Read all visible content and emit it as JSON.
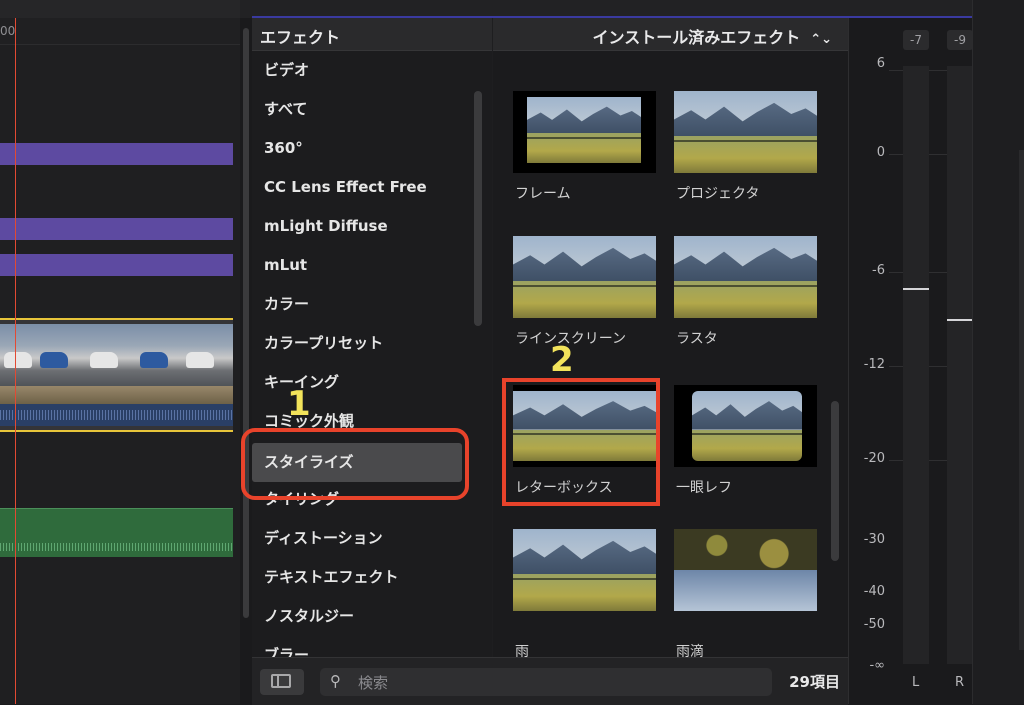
{
  "timeline": {
    "ruler_label": "00"
  },
  "effects_panel": {
    "category_header": "エフェクト",
    "grid_header": "インストール済みエフェクト",
    "categories": [
      "ビデオ",
      "すべて",
      "360°",
      "CC Lens Effect Free",
      "mLight Diffuse",
      "mLut",
      "カラー",
      "カラープリセット",
      "キーイング",
      "コミック外観",
      "スタイライズ",
      "タイリング",
      "ディストーション",
      "テキストエフェクト",
      "ノスタルジー",
      "ブラー"
    ],
    "selected_category": "スタイライズ",
    "tiles": [
      "フレーム",
      "プロジェクタ",
      "ラインスクリーン",
      "ラスタ",
      "レターボックス",
      "一眼レフ",
      "雨",
      "雨滴"
    ],
    "search": {
      "placeholder": "検索"
    },
    "item_count": "29項目"
  },
  "annotations": {
    "step1": "1",
    "step2": "2"
  },
  "audio_meter": {
    "peaks": [
      "-7",
      "-9"
    ],
    "scale": [
      "6",
      "0",
      "-6",
      "-12",
      "-20",
      "-30",
      "-40",
      "-50",
      "-∞"
    ],
    "channels": [
      "L",
      "R"
    ],
    "levels_db": [
      -7,
      -9
    ]
  },
  "colors": {
    "annotation_box": "#e8432b",
    "annotation_number": "#f2e35b",
    "clip_purple": "#5d4aa1",
    "audio_green": "#2f6b3c",
    "selection": "#e7c53a"
  }
}
